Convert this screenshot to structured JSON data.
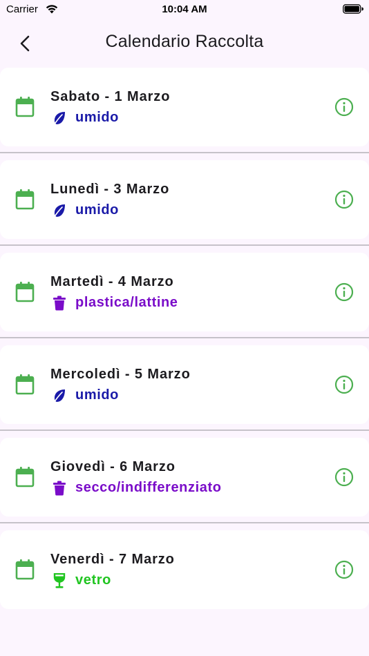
{
  "status_bar": {
    "carrier": "Carrier",
    "time": "10:04 AM"
  },
  "nav": {
    "title": "Calendario Raccolta"
  },
  "colors": {
    "calendar_green": "#4caf50",
    "umido": "#1a1aa8",
    "plastica": "#7a0cc9",
    "secco": "#7a0cc9",
    "vetro": "#21c521"
  },
  "entries": [
    {
      "date": "Sabato - 1 Marzo",
      "type": "umido",
      "icon": "leaf-icon"
    },
    {
      "date": "Lunedì - 3 Marzo",
      "type": "umido",
      "icon": "leaf-icon"
    },
    {
      "date": "Martedì - 4 Marzo",
      "type": "plastica/lattine",
      "icon": "trash-icon"
    },
    {
      "date": "Mercoledì - 5 Marzo",
      "type": "umido",
      "icon": "leaf-icon"
    },
    {
      "date": "Giovedì - 6 Marzo",
      "type": "secco/indifferenziato",
      "icon": "trash-icon"
    },
    {
      "date": "Venerdì - 7 Marzo",
      "type": "vetro",
      "icon": "wine-glass-icon"
    }
  ]
}
